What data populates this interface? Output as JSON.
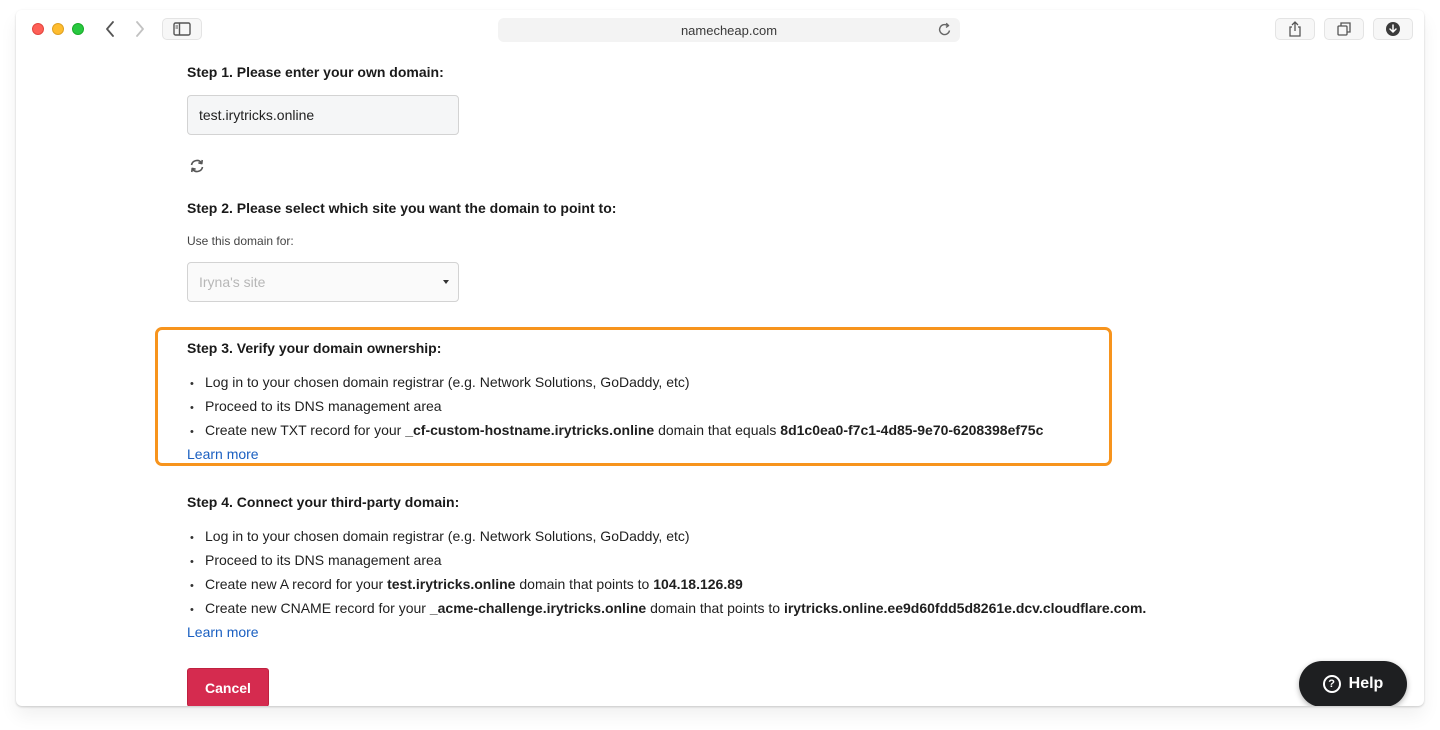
{
  "browser": {
    "url": "namecheap.com"
  },
  "step1": {
    "heading": "Step 1. Please enter your own domain:",
    "domain_value": "test.irytricks.online"
  },
  "step2": {
    "heading": "Step 2. Please select which site you want the domain to point to:",
    "use_for_label": "Use this domain for:",
    "selected_site": "Iryna's site"
  },
  "step3": {
    "heading": "Step 3. Verify your domain ownership:",
    "items": [
      {
        "text": "Log in to your chosen domain registrar (e.g. Network Solutions, GoDaddy, etc)"
      },
      {
        "text": "Proceed to its DNS management area"
      },
      {
        "pre": "Create new TXT record for your ",
        "host": "_cf-custom-hostname.irytricks.online",
        "mid": " domain that equals ",
        "value": "8d1c0ea0-f7c1-4d85-9e70-6208398ef75c"
      }
    ],
    "learn_more": "Learn more",
    "highlight_color": "#f7941d"
  },
  "step4": {
    "heading": "Step 4. Connect your third-party domain:",
    "items": [
      {
        "text": "Log in to your chosen domain registrar (e.g. Network Solutions, GoDaddy, etc)"
      },
      {
        "text": "Proceed to its DNS management area"
      },
      {
        "pre": "Create new A record for your ",
        "host": "test.irytricks.online",
        "mid": " domain that points to ",
        "value": "104.18.126.89"
      },
      {
        "pre": "Create new CNAME record for your ",
        "host": "_acme-challenge.irytricks.online",
        "mid": " domain that points to ",
        "value": "irytricks.online.ee9d60fdd5d8261e.dcv.cloudflare.com."
      }
    ],
    "learn_more": "Learn more"
  },
  "actions": {
    "cancel_label": "Cancel",
    "cancel_color": "#d52b4f",
    "help_label": "Help"
  },
  "icons": [
    "back-icon",
    "forward-icon",
    "sidebar-icon",
    "reload-icon",
    "share-icon",
    "tabs-icon",
    "download-icon",
    "refresh-icon",
    "help-question-icon"
  ]
}
